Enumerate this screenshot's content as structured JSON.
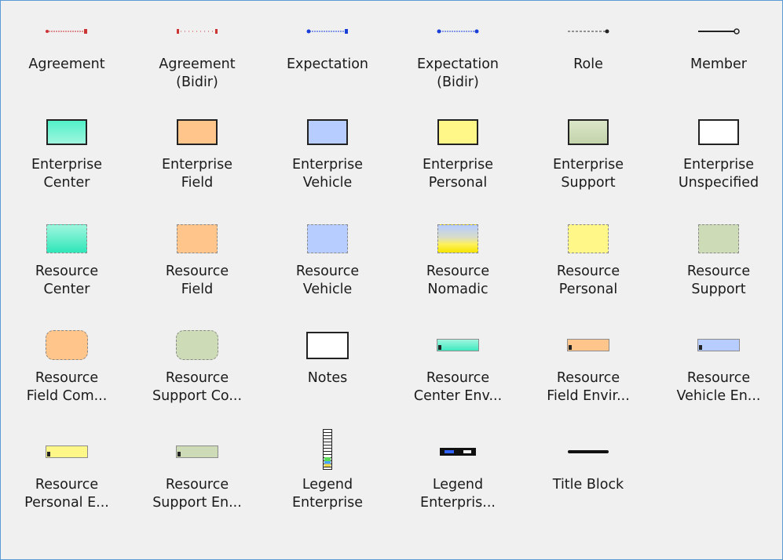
{
  "colors": {
    "center": "#4ff0c8",
    "field": "#ffc58a",
    "vehicle": "#b7ccff",
    "personal": "#fff889",
    "support": "#cddcb6",
    "unspecified": "#ffffff",
    "link_red": "#cc2222",
    "link_blue": "#1a3fd8"
  },
  "tiles": [
    {
      "label": "Agreement",
      "icon": "agreement-link-icon"
    },
    {
      "label": "Agreement\n(Bidir)",
      "icon": "agreement-bidir-link-icon"
    },
    {
      "label": "Expectation",
      "icon": "expectation-link-icon"
    },
    {
      "label": "Expectation\n(Bidir)",
      "icon": "expectation-bidir-link-icon"
    },
    {
      "label": "Role",
      "icon": "role-link-icon"
    },
    {
      "label": "Member",
      "icon": "member-link-icon"
    },
    {
      "label": "Enterprise\nCenter",
      "icon": "enterprise-center-icon"
    },
    {
      "label": "Enterprise\nField",
      "icon": "enterprise-field-icon"
    },
    {
      "label": "Enterprise\nVehicle",
      "icon": "enterprise-vehicle-icon"
    },
    {
      "label": "Enterprise\nPersonal",
      "icon": "enterprise-personal-icon"
    },
    {
      "label": "Enterprise\nSupport",
      "icon": "enterprise-support-icon"
    },
    {
      "label": "Enterprise\nUnspecified",
      "icon": "enterprise-unspecified-icon"
    },
    {
      "label": "Resource\nCenter",
      "icon": "resource-center-icon"
    },
    {
      "label": "Resource\nField",
      "icon": "resource-field-icon"
    },
    {
      "label": "Resource\nVehicle",
      "icon": "resource-vehicle-icon"
    },
    {
      "label": "Resource\nNomadic",
      "icon": "resource-nomadic-icon"
    },
    {
      "label": "Resource\nPersonal",
      "icon": "resource-personal-icon"
    },
    {
      "label": "Resource\nSupport",
      "icon": "resource-support-icon"
    },
    {
      "label": "Resource\nField Com...",
      "icon": "resource-field-community-icon"
    },
    {
      "label": "Resource\nSupport Co...",
      "icon": "resource-support-community-icon"
    },
    {
      "label": "Notes",
      "icon": "notes-icon"
    },
    {
      "label": "Resource\nCenter Env...",
      "icon": "resource-center-environment-icon"
    },
    {
      "label": "Resource\nField Envir...",
      "icon": "resource-field-environment-icon"
    },
    {
      "label": "Resource\nVehicle En...",
      "icon": "resource-vehicle-environment-icon"
    },
    {
      "label": "Resource\nPersonal E...",
      "icon": "resource-personal-environment-icon"
    },
    {
      "label": "Resource\nSupport En...",
      "icon": "resource-support-environment-icon"
    },
    {
      "label": "Legend\nEnterprise",
      "icon": "legend-enterprise-icon"
    },
    {
      "label": "Legend\nEnterpris...",
      "icon": "legend-enterprise-horizontal-icon"
    },
    {
      "label": "Title Block",
      "icon": "title-block-icon"
    }
  ]
}
